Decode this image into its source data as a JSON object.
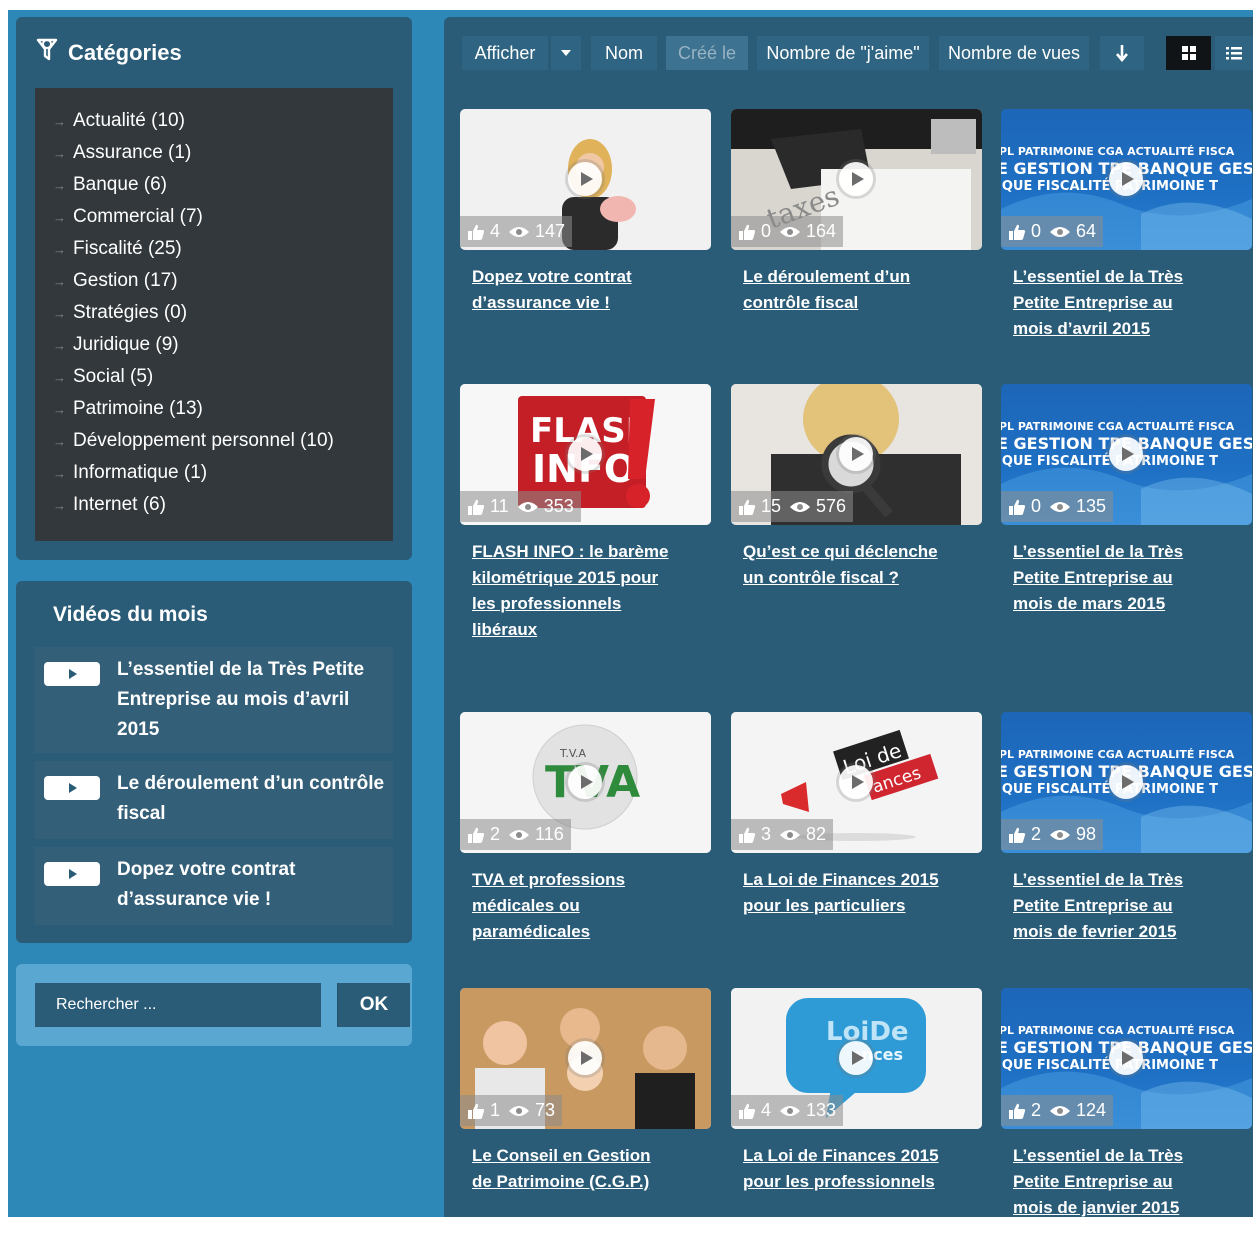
{
  "sidebar": {
    "categories_title": "Catégories",
    "categories": [
      {
        "label": "Actualité (10)"
      },
      {
        "label": "Assurance (1)"
      },
      {
        "label": "Banque (6)"
      },
      {
        "label": "Commercial (7)"
      },
      {
        "label": "Fiscalité (25)"
      },
      {
        "label": "Gestion (17)"
      },
      {
        "label": "Stratégies (0)"
      },
      {
        "label": "Juridique (9)"
      },
      {
        "label": "Social (5)"
      },
      {
        "label": "Patrimoine (13)"
      },
      {
        "label": "Développement personnel (10)"
      },
      {
        "label": "Informatique (1)"
      },
      {
        "label": "Internet (6)"
      }
    ],
    "videos_title": "Vidéos du mois",
    "videos": [
      {
        "label": "L’essentiel de la Très Petite Entreprise au mois d’avril 2015"
      },
      {
        "label": "Le déroulement d’un contrôle fiscal"
      },
      {
        "label": "Dopez votre contrat d’assurance vie !"
      }
    ],
    "search": {
      "placeholder": "Rechercher ...",
      "button": "OK"
    }
  },
  "toolbar": {
    "show": "Afficher",
    "name": "Nom",
    "created": "Créé le",
    "likes": "Nombre de \"j'aime\"",
    "views": "Nombre de vues"
  },
  "banner_text": {
    "line1": "PL PATRIMOINE CGA ACTUALITÉ FISCA",
    "line2": "E GESTION TPE BANQUE GESTIO",
    "line3": "IQUE FISCALITÉ PATRIMOINE T"
  },
  "videos": [
    {
      "likes": "4",
      "views": "147",
      "title": "Dopez votre contrat d’assurance vie !",
      "thumb": "woman-piggybank"
    },
    {
      "likes": "0",
      "views": "164",
      "title": "Le déroulement d’un contrôle fiscal",
      "thumb": "man-documents"
    },
    {
      "likes": "0",
      "views": "64",
      "title": "L’essentiel de la Très Petite Entreprise au mois d’avril 2015",
      "thumb": "blue-banner"
    },
    {
      "likes": "11",
      "views": "353",
      "title": "FLASH INFO : le barème kilométrique 2015 pour les professionnels libéraux",
      "thumb": "flash-info"
    },
    {
      "likes": "15",
      "views": "576",
      "title": "Qu’est ce qui déclenche un contrôle fiscal ?",
      "thumb": "magnifier-woman"
    },
    {
      "likes": "0",
      "views": "135",
      "title": "L’essentiel de la Très Petite Entreprise au mois de mars 2015",
      "thumb": "blue-banner"
    },
    {
      "likes": "2",
      "views": "116",
      "title": "TVA et professions médicales ou paramédicales",
      "thumb": "tva-globe"
    },
    {
      "likes": "3",
      "views": "82",
      "title": "La Loi de Finances 2015 pour les particuliers",
      "thumb": "loi-de-finances"
    },
    {
      "likes": "2",
      "views": "98",
      "title": "L’essentiel de la Très Petite Entreprise au mois de fevrier 2015",
      "thumb": "blue-banner"
    },
    {
      "likes": "1",
      "views": "73",
      "title": "Le Conseil en Gestion de Patrimoine (C.G.P.)",
      "thumb": "family"
    },
    {
      "likes": "4",
      "views": "133",
      "title": "La Loi de Finances 2015 pour les professionnels",
      "thumb": "speech-bubble"
    },
    {
      "likes": "2",
      "views": "124",
      "title": "L’essentiel de la Très Petite Entreprise au mois de janvier 2015",
      "thumb": "blue-banner"
    }
  ]
}
